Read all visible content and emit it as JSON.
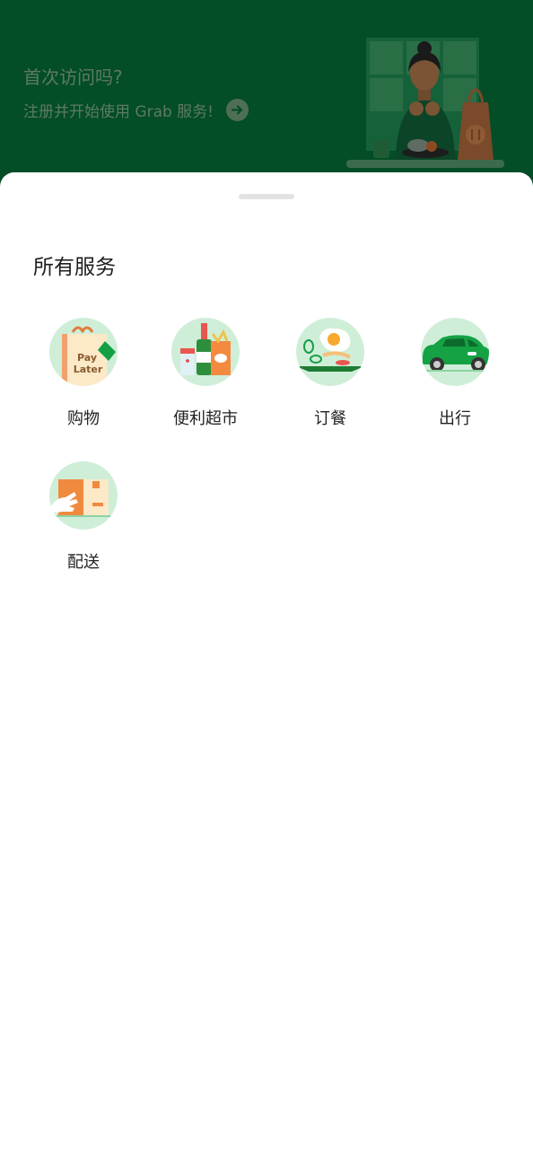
{
  "banner": {
    "title": "首次访问吗?",
    "subtitle": "注册并开始使用 Grab 服务!",
    "arrow_icon": "arrow-right-icon",
    "background": "#034d27",
    "text_color": "#5e7a63"
  },
  "services": {
    "title": "所有服务",
    "items": [
      {
        "label": "购物",
        "icon": "paylater-bag-icon",
        "badge_text_1": "Pay",
        "badge_text_2": "Later"
      },
      {
        "label": "便利超市",
        "icon": "grocery-icon"
      },
      {
        "label": "订餐",
        "icon": "food-icon"
      },
      {
        "label": "出行",
        "icon": "car-icon"
      },
      {
        "label": "配送",
        "icon": "delivery-box-icon"
      }
    ],
    "icon_bg": "#cfeed8"
  }
}
